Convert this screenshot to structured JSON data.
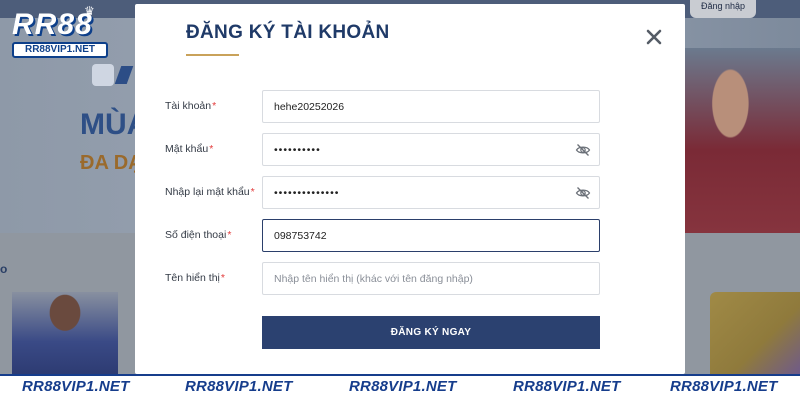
{
  "brand": {
    "logo_text": "RR88",
    "logo_subtext": "RR88VIP1.NET"
  },
  "background": {
    "login_button": "Đăng nhập",
    "hero_line1": "MÙA",
    "hero_line2": "ĐA DẠ",
    "side_fragment": "o"
  },
  "modal": {
    "title": "ĐĂNG KÝ TÀI KHOẢN",
    "fields": [
      {
        "label": "Tài khoản",
        "required_mark": "*",
        "value": "hehe20252026",
        "placeholder": ""
      },
      {
        "label": "Mật khẩu",
        "required_mark": "*",
        "value": "••••••••••",
        "placeholder": ""
      },
      {
        "label": "Nhập lại mật khẩu",
        "required_mark": "*",
        "value": "••••••••••••••",
        "placeholder": ""
      },
      {
        "label": "Số điện thoại",
        "required_mark": "*",
        "value": "098753742",
        "placeholder": ""
      },
      {
        "label": "Tên hiển thị",
        "required_mark": "*",
        "value": "",
        "placeholder": "Nhập tên hiển thị (khác với tên đăng nhập)"
      }
    ],
    "submit_label": "ĐĂNG KÝ NGAY"
  },
  "watermark": {
    "items": [
      "RR88VIP1.NET",
      "RR88VIP1.NET",
      "RR88VIP1.NET",
      "RR88VIP1.NET",
      "RR88VIP1.NET"
    ]
  },
  "colors": {
    "title": "#1f3a68",
    "accent_underline": "#c9a25a",
    "required": "#e33b3b",
    "submit_bg": "#2b4170",
    "watermark": "#163d8c"
  },
  "icons": {
    "close": "close-icon",
    "password_toggle": "eye-off-icon"
  }
}
